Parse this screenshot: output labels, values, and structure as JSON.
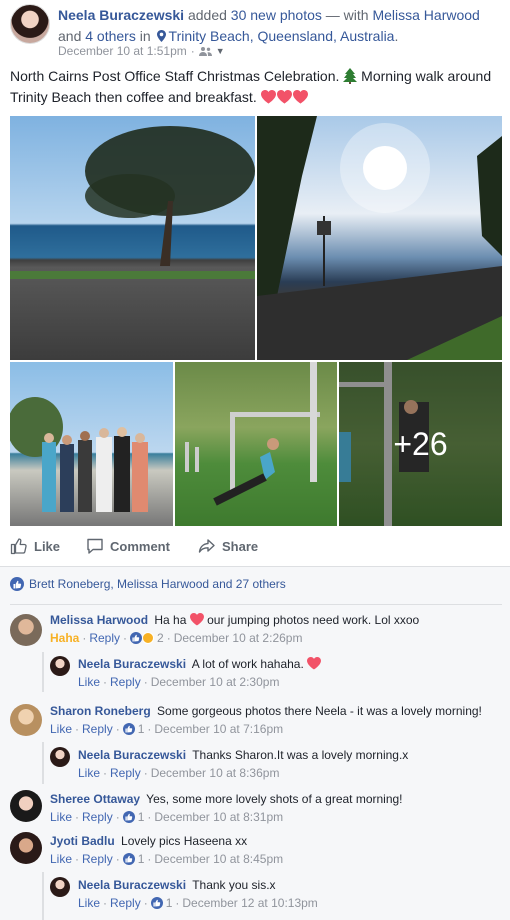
{
  "post": {
    "author": "Neela Buraczewski",
    "action": "added",
    "photo_count_text": "30 new photos",
    "with_text": "— with",
    "tagged_person": "Melissa Harwood",
    "and_text": "and",
    "others_text": "4 others",
    "in_text": "in",
    "location": "Trinity Beach, Queensland, Australia",
    "location_end": ".",
    "timestamp": "December 10 at 1:51pm",
    "caption_part1": "North Cairns Post Office Staff Christmas Celebration.",
    "caption_part2": "Morning walk around Trinity Beach then coffee and breakfast.",
    "more_photos_label": "+26"
  },
  "actions": {
    "like_label": "Like",
    "comment_label": "Comment",
    "share_label": "Share"
  },
  "likes_summary": "Brett Roneberg, Melissa Harwood and 27 others",
  "colors": {
    "link_blue": "#365899",
    "facebook_blue": "#4267b2",
    "meta_grey": "#90949c",
    "haha_yellow": "#f7b125",
    "heart_red": "#f25268"
  },
  "comments": [
    {
      "author": "Melissa Harwood",
      "text_before": "Ha ha",
      "text_after": "our jumping photos need work. Lol xxoo",
      "reaction_label": "Haha",
      "reply_label": "Reply",
      "reaction_count": "2",
      "time": "December 10 at 2:26pm",
      "reply": {
        "author": "Neela Buraczewski",
        "text": "A lot of work hahaha.",
        "like_label": "Like",
        "reply_label": "Reply",
        "time": "December 10 at 2:30pm"
      }
    },
    {
      "author": "Sharon Roneberg",
      "text": "Some gorgeous photos there Neela - it was a lovely morning!",
      "like_label": "Like",
      "reply_label": "Reply",
      "reaction_count": "1",
      "time": "December 10 at 7:16pm",
      "reply": {
        "author": "Neela Buraczewski",
        "text": "Thanks Sharon.It was a lovely morning.x",
        "like_label": "Like",
        "reply_label": "Reply",
        "time": "December 10 at 8:36pm"
      }
    },
    {
      "author": "Sheree Ottaway",
      "text": "Yes, some more lovely shots of a great morning!",
      "like_label": "Like",
      "reply_label": "Reply",
      "reaction_count": "1",
      "time": "December 10 at 8:31pm"
    },
    {
      "author": "Jyoti Badlu",
      "text": "Lovely pics Haseena xx",
      "like_label": "Like",
      "reply_label": "Reply",
      "reaction_count": "1",
      "time": "December 10 at 8:45pm",
      "reply": {
        "author": "Neela Buraczewski",
        "text": "Thank you sis.x",
        "like_label": "Like",
        "reply_label": "Reply",
        "reaction_count": "1",
        "time": "December 12 at 10:13pm"
      }
    }
  ]
}
